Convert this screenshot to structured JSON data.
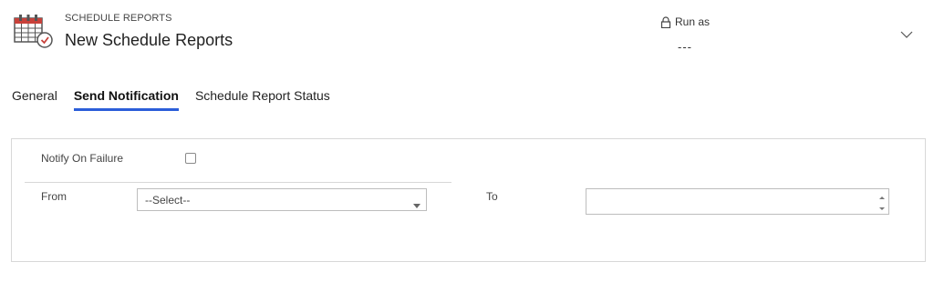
{
  "header": {
    "entity_type": "SCHEDULE REPORTS",
    "title": "New Schedule Reports",
    "icon": "calendar-clock-icon",
    "runas": {
      "label": "Run as",
      "value": "---",
      "icon": "lock-icon"
    },
    "expand_icon": "chevron-down-icon"
  },
  "tabs": [
    {
      "label": "General",
      "active": false
    },
    {
      "label": "Send Notification",
      "active": true
    },
    {
      "label": "Schedule Report Status",
      "active": false
    }
  ],
  "notification_section": {
    "notify_on_failure": {
      "label": "Notify On Failure",
      "checked": false
    },
    "from": {
      "label": "From",
      "selected": "--Select--"
    },
    "to": {
      "label": "To",
      "value": ""
    }
  },
  "colors": {
    "accent": "#2b5ed9",
    "icon_red": "#c8413a",
    "border": "#d8d8d8"
  }
}
